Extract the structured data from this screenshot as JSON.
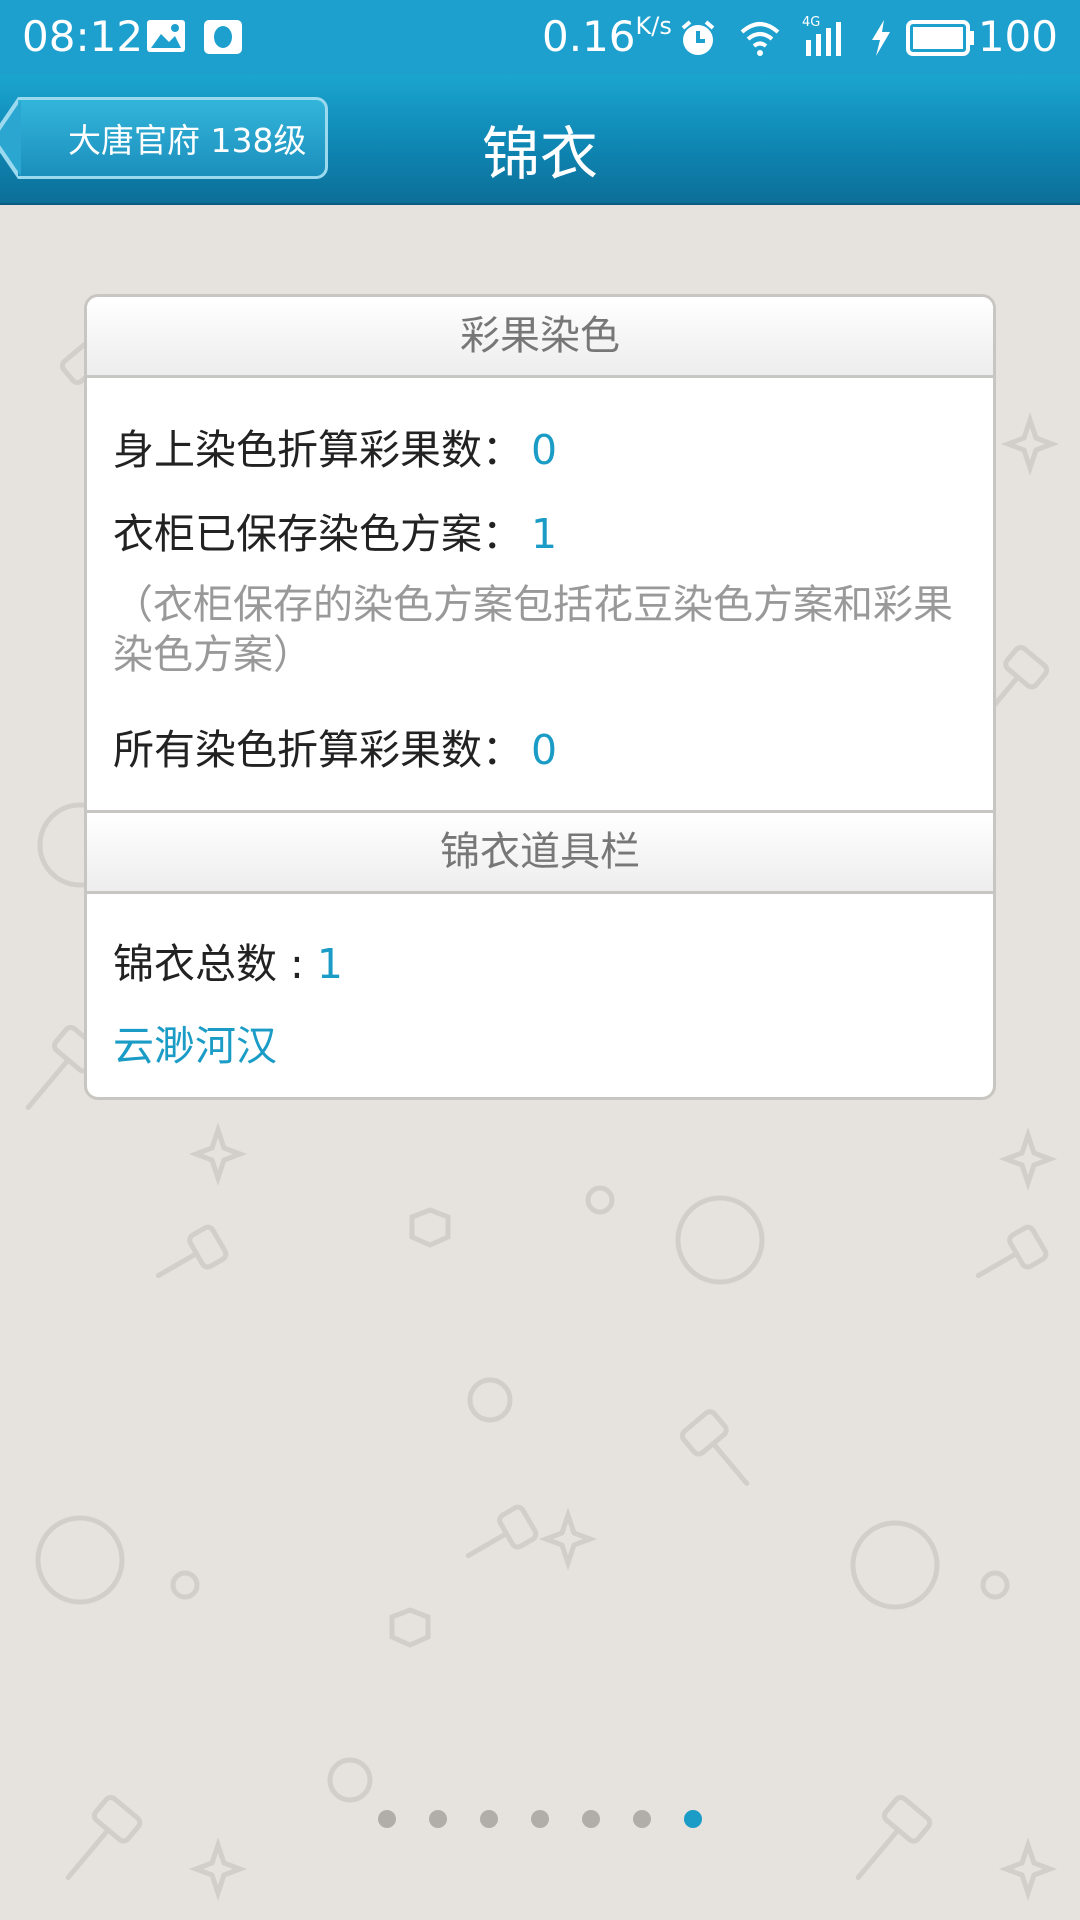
{
  "statusbar": {
    "time": "08:12",
    "net_speed": "0.16",
    "net_unit": "K/s",
    "network_type": "4G",
    "battery": "100"
  },
  "header": {
    "back_label": "大唐官府 138级",
    "title": "锦衣"
  },
  "sections": [
    {
      "title": "彩果染色",
      "rows": [
        {
          "label": "身上染色折算彩果数：",
          "value": "0"
        },
        {
          "label": "衣柜已保存染色方案：",
          "value": "1"
        },
        {
          "note": "（衣柜保存的染色方案包括花豆染色方案和彩果染色方案）"
        },
        {
          "label": "所有染色折算彩果数：",
          "value": "0"
        }
      ]
    },
    {
      "title": "锦衣道具栏",
      "total_label": "锦衣总数 : ",
      "total_value": "1",
      "items": [
        "云渺河汉"
      ]
    }
  ],
  "pagination": {
    "count": 7,
    "active_index": 6
  },
  "colors": {
    "accent": "#1b9cc6",
    "statusbar": "#1ea0cf",
    "background": "#e6e3de"
  }
}
